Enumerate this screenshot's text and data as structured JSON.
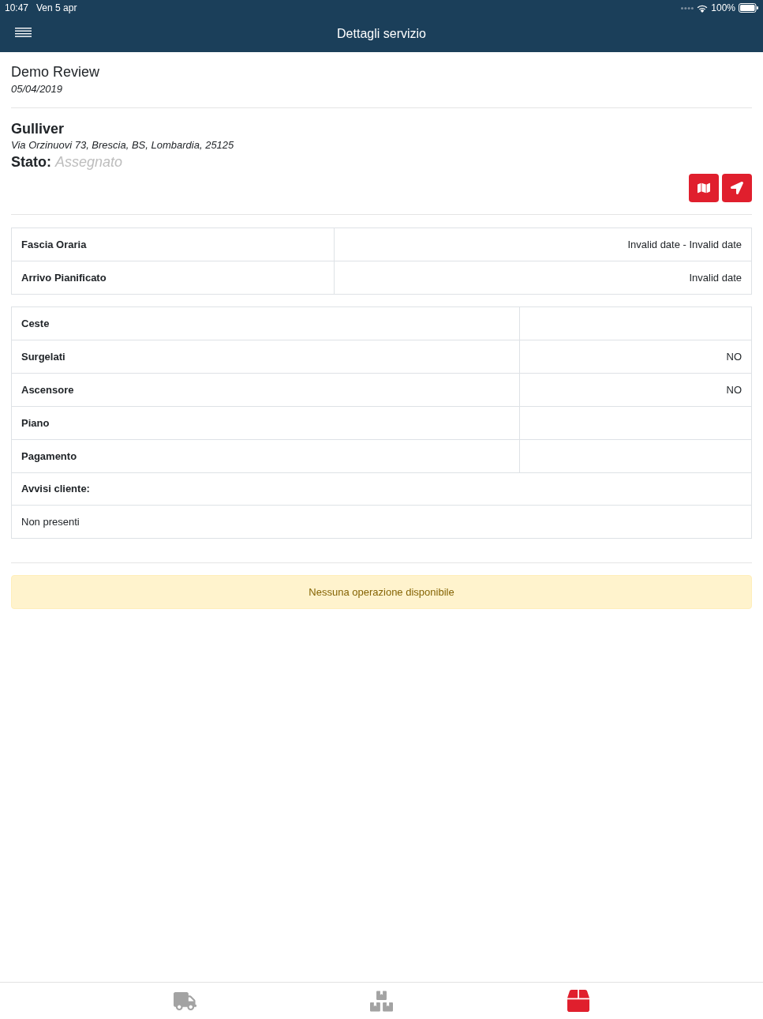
{
  "status_bar": {
    "time": "10:47",
    "date": "Ven 5 apr",
    "battery": "100%"
  },
  "nav_bar": {
    "title": "Dettagli servizio"
  },
  "service": {
    "name": "Demo Review",
    "date": "05/04/2019"
  },
  "customer": {
    "name": "Gulliver",
    "address": "Via Orzinuovi 73, Brescia, BS, Lombardia, 25125",
    "status_label": "Stato:",
    "status_value": "Assegnato"
  },
  "action_buttons": [
    {
      "kind": "map"
    },
    {
      "kind": "navigate"
    }
  ],
  "schedule_table": [
    {
      "label": "Fascia Oraria",
      "value": "Invalid date - Invalid date"
    },
    {
      "label": "Arrivo Pianificato",
      "value": "Invalid date"
    }
  ],
  "details_table": [
    {
      "kind": "pair",
      "label": "Ceste"
    },
    {
      "kind": "pair",
      "label": "Surgelati",
      "value": "NO"
    },
    {
      "kind": "pair",
      "label": "Ascensore",
      "value": "NO"
    },
    {
      "kind": "pair",
      "label": "Piano"
    },
    {
      "kind": "pair",
      "label": "Pagamento"
    },
    {
      "kind": "heading",
      "label": "Avvisi cliente:"
    },
    {
      "kind": "note",
      "label": "Non presenti"
    }
  ],
  "alert": {
    "message": "Nessuna operazione disponibile"
  },
  "tab_bar": [
    {
      "kind": "truck",
      "selected": false
    },
    {
      "kind": "boxes",
      "selected": false
    },
    {
      "kind": "box",
      "selected": true
    }
  ]
}
